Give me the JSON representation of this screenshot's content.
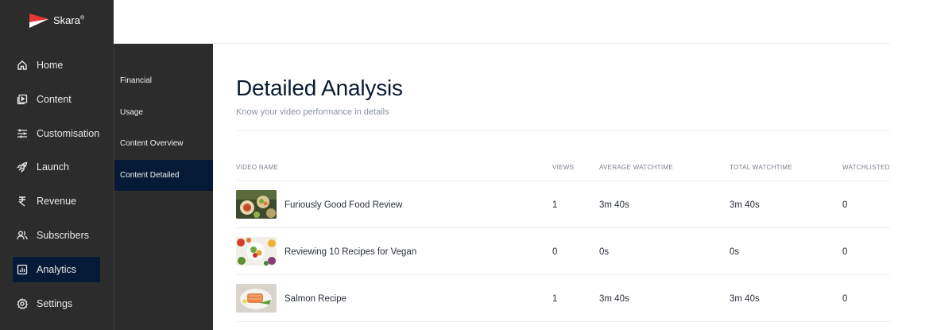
{
  "brand": {
    "name": "Skara",
    "mark": "®"
  },
  "nav": {
    "items": [
      {
        "label": "Home",
        "icon": "home-icon",
        "active": false
      },
      {
        "label": "Content",
        "icon": "play-square-icon",
        "active": false
      },
      {
        "label": "Customisation",
        "icon": "sliders-icon",
        "active": false
      },
      {
        "label": "Launch",
        "icon": "rocket-icon",
        "active": false
      },
      {
        "label": "Revenue",
        "icon": "rupee-icon",
        "active": false
      },
      {
        "label": "Subscribers",
        "icon": "users-icon",
        "active": false
      },
      {
        "label": "Analytics",
        "icon": "bar-chart-icon",
        "active": true
      },
      {
        "label": "Settings",
        "icon": "gear-icon",
        "active": false
      }
    ]
  },
  "subnav": {
    "items": [
      {
        "label": "Financial",
        "active": false
      },
      {
        "label": "Usage",
        "active": false
      },
      {
        "label": "Content Overview",
        "active": false
      },
      {
        "label": "Content Detailed",
        "active": true
      }
    ]
  },
  "page": {
    "title": "Detailed Analysis",
    "subtitle": "Know your video performance in details"
  },
  "table": {
    "columns": [
      "VIDEO NAME",
      "VIEWS",
      "AVERAGE WATCHTIME",
      "TOTAL WATCHTIME",
      "WATCHLISTED"
    ],
    "rows": [
      {
        "name": "Furiously Good Food Review",
        "views": "1",
        "avg": "3m 40s",
        "total": "3m 40s",
        "watchlisted": "0"
      },
      {
        "name": "Reviewing 10 Recipes for Vegan",
        "views": "0",
        "avg": "0s",
        "total": "0s",
        "watchlisted": "0"
      },
      {
        "name": "Salmon Recipe",
        "views": "1",
        "avg": "3m 40s",
        "total": "3m 40s",
        "watchlisted": "0"
      }
    ]
  },
  "colors": {
    "sidebar_bg": "#2c2c2c",
    "active_bg": "#051a36",
    "brand_red": "#e53935",
    "title": "#0b1a33"
  }
}
